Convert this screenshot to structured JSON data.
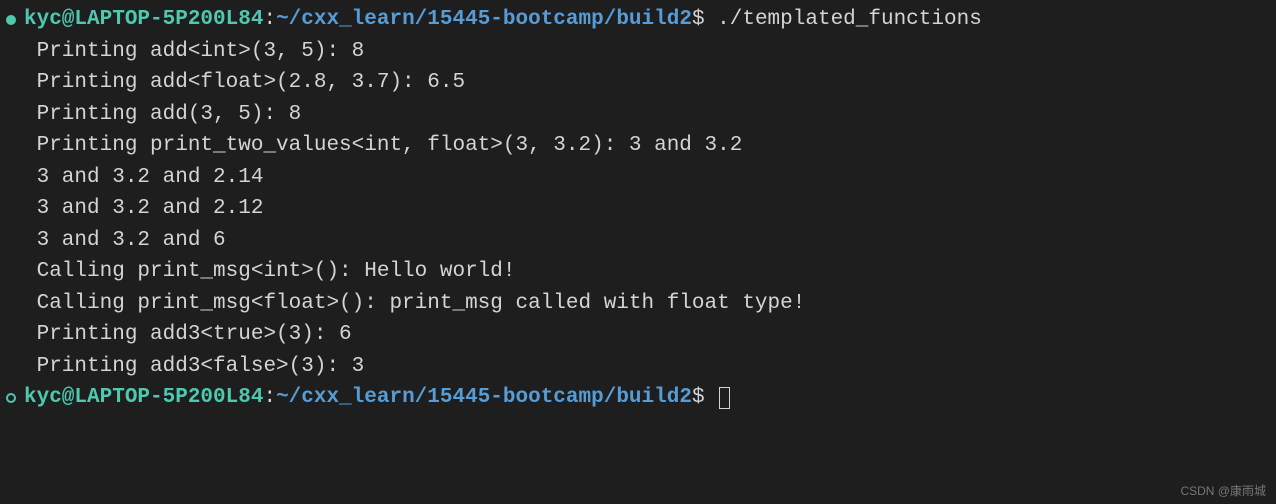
{
  "prompt1": {
    "user_host": "kyc@LAPTOP-5P200L84",
    "colon": ":",
    "path": "~/cxx_learn/15445-bootcamp/build2",
    "dollar": "$",
    "command": " ./templated_functions"
  },
  "output_lines": [
    " Printing add<int>(3, 5): 8",
    " Printing add<float>(2.8, 3.7): 6.5",
    " Printing add(3, 5): 8",
    " Printing print_two_values<int, float>(3, 3.2): 3 and 3.2",
    " 3 and 3.2 and 2.14",
    " 3 and 3.2 and 2.12",
    " 3 and 3.2 and 6",
    " Calling print_msg<int>(): Hello world!",
    " Calling print_msg<float>(): print_msg called with float type!",
    " Printing add3<true>(3): 6",
    " Printing add3<false>(3): 3"
  ],
  "prompt2": {
    "user_host": "kyc@LAPTOP-5P200L84",
    "colon": ":",
    "path": "~/cxx_learn/15445-bootcamp/build2",
    "dollar": "$"
  },
  "watermark": "CSDN @康雨城"
}
